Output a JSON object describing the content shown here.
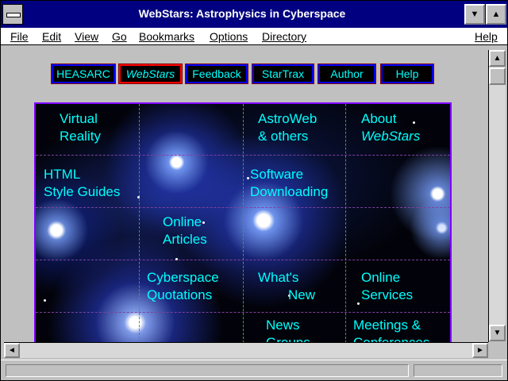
{
  "window": {
    "title": "WebStars: Astrophysics in Cyberspace"
  },
  "menu": {
    "file": "File",
    "edit": "Edit",
    "view": "View",
    "go": "Go",
    "bookmarks": "Bookmarks",
    "options": "Options",
    "directory": "Directory",
    "help": "Help"
  },
  "nav": {
    "heasarc": "HEASARC",
    "webstars": "WebStars",
    "feedback": "Feedback",
    "startrax": "StarTrax",
    "author": "Author",
    "help": "Help"
  },
  "cells": {
    "virtual_reality_1": "Virtual",
    "virtual_reality_2": "Reality",
    "astroweb_1": "AstroWeb",
    "astroweb_2": "& others",
    "about_1": "About",
    "about_2": "WebStars",
    "html_1": "HTML",
    "html_2": "Style Guides",
    "software_1": "Software",
    "software_2": "Downloading",
    "online_articles_1": "Online",
    "online_articles_2": "Articles",
    "cyberspace_1": "Cyberspace",
    "cyberspace_2": "Quotations",
    "whats_new_1": "What's",
    "whats_new_2": "New",
    "online_services_1": "Online",
    "online_services_2": "Services",
    "news_1": "News",
    "news_2": "Groups",
    "meetings_1": "Meetings &",
    "meetings_2": "Conferences"
  },
  "colors": {
    "link_cyan": "#00ffff",
    "titlebar_navy": "#000080",
    "nav_border": "#0000ff",
    "active_border": "#ff0000"
  },
  "icons": {
    "system_menu": "system-menu-icon",
    "minimize": "down-triangle",
    "maximize": "up-triangle",
    "scroll_up": "up-arrow",
    "scroll_down": "down-arrow",
    "scroll_left": "left-arrow",
    "scroll_right": "right-arrow"
  }
}
